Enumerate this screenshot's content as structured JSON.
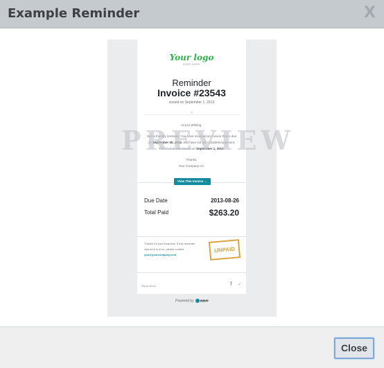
{
  "dialog": {
    "title": "Example Reminder",
    "close_x": "X",
    "close_button": "Close"
  },
  "preview": {
    "logo_text": "Your logo",
    "logo_sub": "GOES HERE",
    "heading": "Reminder",
    "invoice_title": "Invoice #23543",
    "issued": "issued on September 1, 2013",
    "of": "of",
    "greeting": "Hi Lex Whiting,",
    "message_parts": [
      "Just a friendly reminder: You have received an invoice that is due on ",
      "September 30, 2013",
      ", and have not yet completed payment. The invoice was issued on ",
      "September 1, 2013",
      "."
    ],
    "thanks": "Thanks,",
    "company": "Your Company Inc.",
    "view_button": "View This Invoice →",
    "due_date_label": "Due Date",
    "due_date_value": "2013-08-26",
    "total_paid_label": "Total Paid",
    "total_paid_value": "$263.20",
    "footer_text": "Thanks for your business. If this reminder was sent in error, please contact ",
    "footer_email": "you@yourcompany.com",
    "stamp": "UNPAID",
    "report_link": "Report abuse",
    "social": {
      "facebook": "f",
      "twitter": "✓"
    },
    "powered_prefix": "Powered by",
    "powered_brand": "wave",
    "watermark": "PREVIEW"
  }
}
